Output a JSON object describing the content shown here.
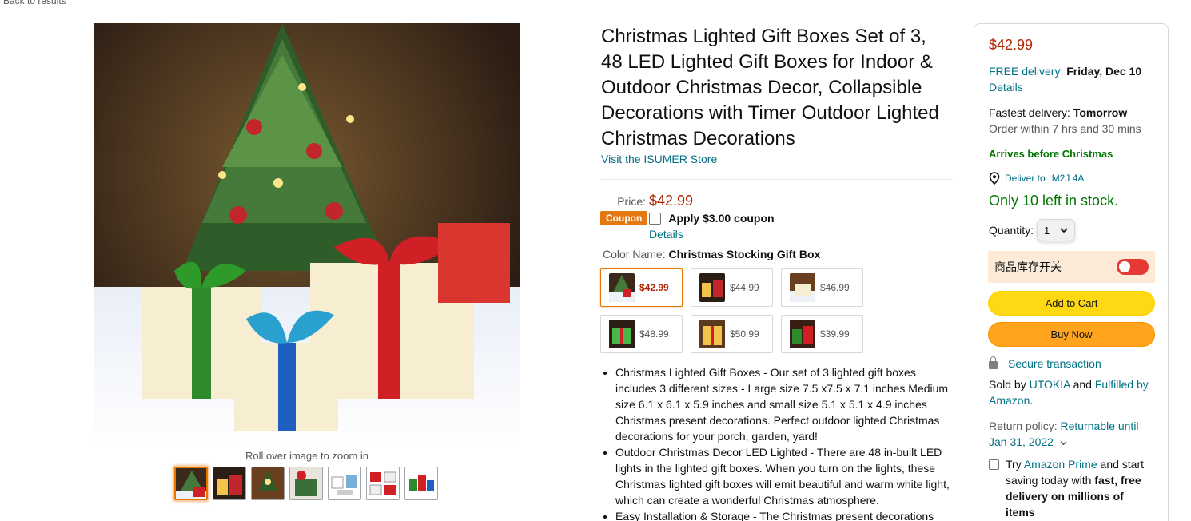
{
  "nav": {
    "back": "Back to results"
  },
  "image": {
    "zoom_hint": "Roll over image to zoom in",
    "thumb_count": 7
  },
  "product": {
    "title": "Christmas Lighted Gift Boxes Set of 3, 48 LED Lighted Gift Boxes for Indoor & Outdoor Christmas Decor, Collapsible Decorations with Timer Outdoor Lighted Christmas Decorations",
    "store": "Visit the ISUMER Store",
    "price_label": "Price:",
    "price": "$42.99",
    "coupon_badge": "Coupon",
    "coupon_text": "Apply $3.00 coupon",
    "coupon_details": "Details",
    "color_label": "Color Name:",
    "color_value": "Christmas Stocking Gift Box",
    "swatches": [
      {
        "price": "$42.99"
      },
      {
        "price": "$44.99"
      },
      {
        "price": "$46.99"
      },
      {
        "price": "$48.99"
      },
      {
        "price": "$50.99"
      },
      {
        "price": "$39.99"
      }
    ],
    "bullets": [
      "Christmas Lighted Gift Boxes - Our set of 3 lighted gift boxes includes 3 different sizes - Large size 7.5 x7.5 x 7.1 inches Medium size 6.1 x 6.1 x 5.9 inches and small size 5.1 x 5.1 x 4.9 inches Christmas present decorations. Perfect outdoor lighted Christmas decorations for your porch, garden, yard!",
      "Outdoor Christmas Decor LED Lighted - There are 48 in-built LED lights in the lighted gift boxes. When you turn on the lights, these Christmas lighted gift boxes will emit beautiful and warm white light, which can create a wonderful Christmas atmosphere.",
      "Easy Installation & Storage - The Christmas present decorations"
    ]
  },
  "buybox": {
    "price": "$42.99",
    "free_delivery": "FREE delivery:",
    "delivery_date": "Friday, Dec 10",
    "details": "Details",
    "fastest_label": "Fastest delivery:",
    "fastest_value": "Tomorrow",
    "order_within": "Order within 7 hrs and 30 mins",
    "arrives": "Arrives before Christmas",
    "deliver_to": "Deliver to",
    "postal": "M2J 4A",
    "stock": "Only 10 left in stock.",
    "qty_label": "Quantity:",
    "qty_value": "1",
    "toggle_label": "商品库存开关",
    "add_to_cart": "Add to Cart",
    "buy_now": "Buy Now",
    "secure": "Secure transaction",
    "sold_by": "Sold by",
    "seller": "UTOKIA",
    "and": "and",
    "fulfilled": "Fulfilled by Amazon",
    "return_label": "Return policy:",
    "return_value": "Returnable until Jan 31, 2022",
    "prime_try": "Try",
    "prime_link": "Amazon Prime",
    "prime_rest": "and start saving today with",
    "prime_bold": "fast, free delivery on millions of items"
  },
  "colors": {
    "link": "#007185",
    "price": "#b12704",
    "green": "#007600",
    "cart": "#ffd814",
    "buy": "#ffa41c",
    "coupon": "#e47911",
    "toggle": "#e53935"
  }
}
